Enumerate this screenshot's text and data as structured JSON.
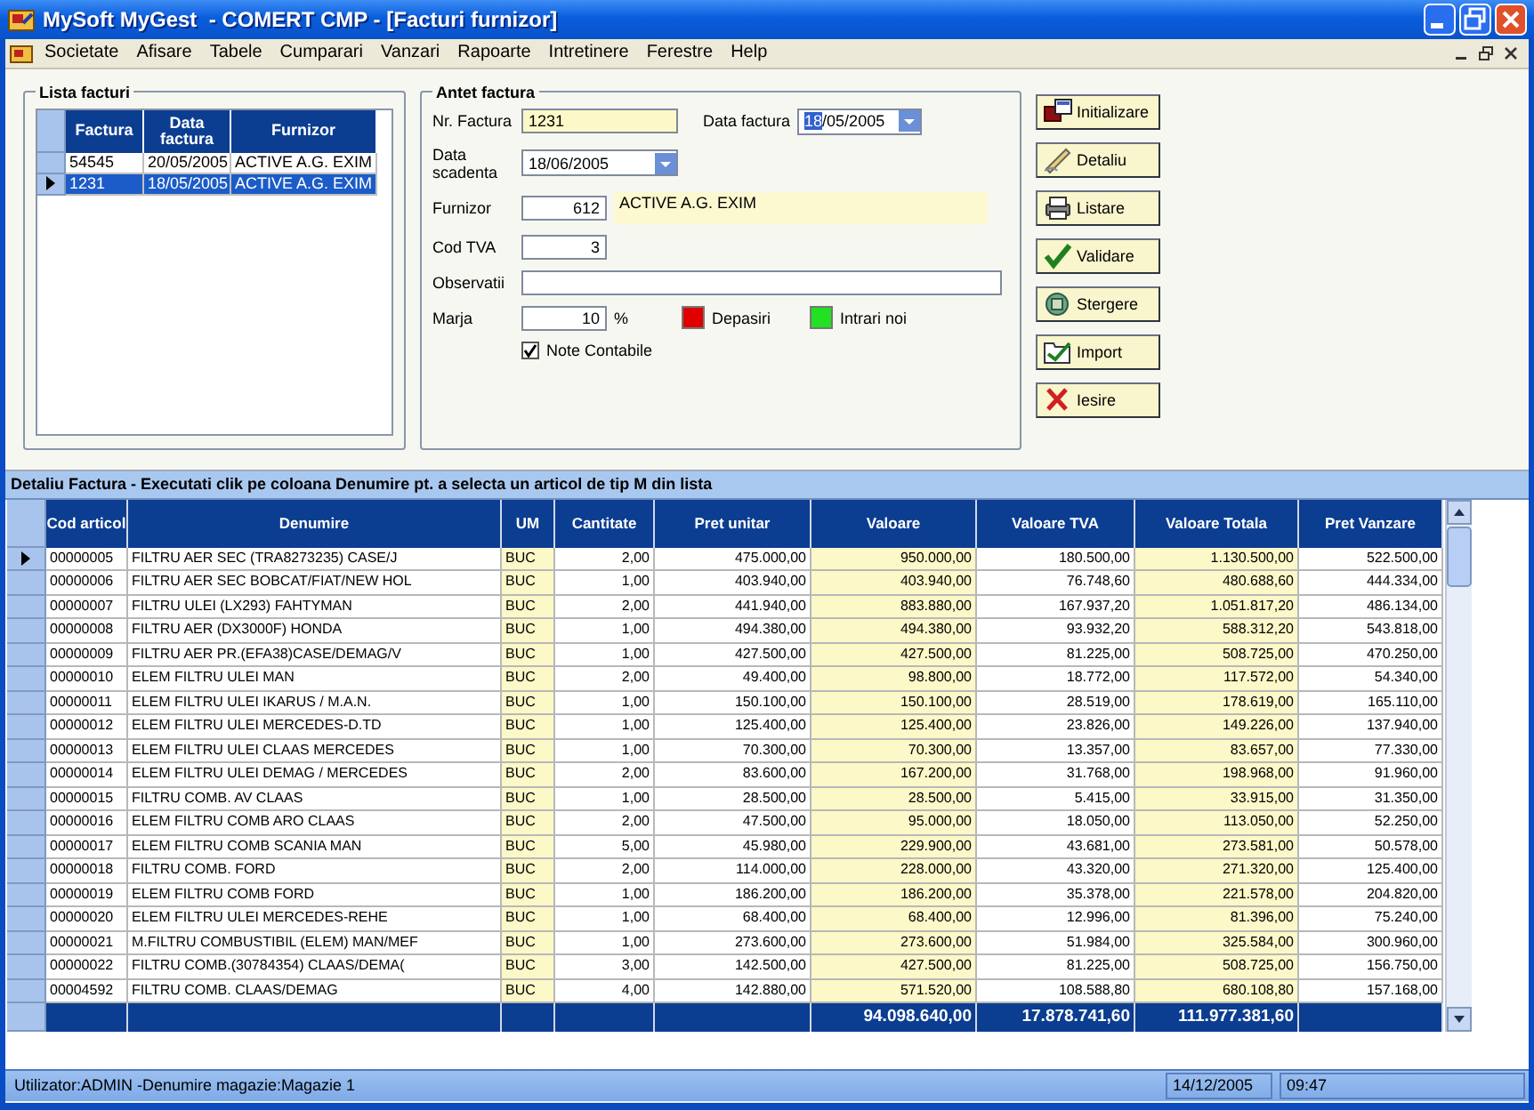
{
  "window": {
    "title": "MySoft MyGest  - COMERT CMP - [Facturi furnizor]"
  },
  "menu": [
    "Societate",
    "Afisare",
    "Tabele",
    "Cumparari",
    "Vanzari",
    "Rapoarte",
    "Intretinere",
    "Ferestre",
    "Help"
  ],
  "invoice_list": {
    "title": "Lista facturi",
    "columns": [
      "Factura",
      "Data factura",
      "Furnizor"
    ],
    "rows": [
      {
        "selected": false,
        "cells": [
          "54545",
          "20/05/2005",
          "ACTIVE A.G. EXIM"
        ]
      },
      {
        "selected": true,
        "cells": [
          "1231",
          "18/05/2005",
          "ACTIVE A.G. EXIM"
        ]
      }
    ]
  },
  "invoice_header": {
    "title": "Antet factura",
    "nr_factura": {
      "label": "Nr. Factura",
      "value": "1231"
    },
    "data_factura": {
      "label": "Data factura",
      "day": "18",
      "rest": "/05/2005",
      "day_selected": true
    },
    "data_scadenta": {
      "label": "Data scadenta",
      "value": "18/06/2005"
    },
    "furnizor": {
      "label": "Furnizor",
      "code": "612",
      "name": "ACTIVE A.G. EXIM"
    },
    "cod_tva": {
      "label": "Cod TVA",
      "value": "3"
    },
    "observatii": {
      "label": "Observatii"
    },
    "marja": {
      "label": "Marja",
      "value": "10",
      "unit": "%"
    },
    "legend": [
      {
        "label": "Depasiri",
        "color": "#e00000"
      },
      {
        "label": "Intrari noi",
        "color": "#22e022"
      }
    ],
    "note_contabile": {
      "label": "Note Contabile",
      "checked": true
    }
  },
  "buttons": [
    {
      "label": "Initializare",
      "kind": "new"
    },
    {
      "label": "Detaliu",
      "kind": "edit"
    },
    {
      "label": "Listare",
      "kind": "print"
    },
    {
      "label": "Validare",
      "kind": "validate"
    },
    {
      "label": "Stergere",
      "kind": "delete"
    },
    {
      "label": "Import",
      "kind": "import"
    },
    {
      "label": "Iesire",
      "kind": "exit"
    }
  ],
  "detail": {
    "title": "Detaliu Factura - Executati clik pe coloana Denumire pt. a selecta un articol de tip M din lista",
    "columns": [
      "Cod articol",
      "Denumire",
      "UM",
      "Cantitate",
      "Pret unitar",
      "Valoare",
      "Valoare TVA",
      "Valoare Totala",
      "Pret Vanzare"
    ],
    "rows": [
      {
        "current": true,
        "cells": [
          "00000005",
          "FILTRU AER SEC (TRA8273235) CASE/J",
          "BUC",
          "2,00",
          "475.000,00",
          "950.000,00",
          "180.500,00",
          "1.130.500,00",
          "522.500,00"
        ]
      },
      {
        "current": false,
        "cells": [
          "00000006",
          "FILTRU AER SEC BOBCAT/FIAT/NEW HOL",
          "BUC",
          "1,00",
          "403.940,00",
          "403.940,00",
          "76.748,60",
          "480.688,60",
          "444.334,00"
        ]
      },
      {
        "current": false,
        "cells": [
          "00000007",
          "FILTRU ULEI (LX293) FAHTYMAN",
          "BUC",
          "2,00",
          "441.940,00",
          "883.880,00",
          "167.937,20",
          "1.051.817,20",
          "486.134,00"
        ]
      },
      {
        "current": false,
        "cells": [
          "00000008",
          "FILTRU AER (DX3000F) HONDA",
          "BUC",
          "1,00",
          "494.380,00",
          "494.380,00",
          "93.932,20",
          "588.312,20",
          "543.818,00"
        ]
      },
      {
        "current": false,
        "cells": [
          "00000009",
          "FILTRU AER PR.(EFA38)CASE/DEMAG/V",
          "BUC",
          "1,00",
          "427.500,00",
          "427.500,00",
          "81.225,00",
          "508.725,00",
          "470.250,00"
        ]
      },
      {
        "current": false,
        "cells": [
          "00000010",
          "ELEM FILTRU ULEI MAN",
          "BUC",
          "2,00",
          "49.400,00",
          "98.800,00",
          "18.772,00",
          "117.572,00",
          "54.340,00"
        ]
      },
      {
        "current": false,
        "cells": [
          "00000011",
          "ELEM FILTRU ULEI IKARUS / M.A.N.",
          "BUC",
          "1,00",
          "150.100,00",
          "150.100,00",
          "28.519,00",
          "178.619,00",
          "165.110,00"
        ]
      },
      {
        "current": false,
        "cells": [
          "00000012",
          "ELEM FILTRU ULEI MERCEDES-D.TD",
          "BUC",
          "1,00",
          "125.400,00",
          "125.400,00",
          "23.826,00",
          "149.226,00",
          "137.940,00"
        ]
      },
      {
        "current": false,
        "cells": [
          "00000013",
          "ELEM FILTRU ULEI CLAAS MERCEDES",
          "BUC",
          "1,00",
          "70.300,00",
          "70.300,00",
          "13.357,00",
          "83.657,00",
          "77.330,00"
        ]
      },
      {
        "current": false,
        "cells": [
          "00000014",
          "ELEM FILTRU ULEI DEMAG / MERCEDES",
          "BUC",
          "2,00",
          "83.600,00",
          "167.200,00",
          "31.768,00",
          "198.968,00",
          "91.960,00"
        ]
      },
      {
        "current": false,
        "cells": [
          "00000015",
          "FILTRU COMB. AV CLAAS",
          "BUC",
          "1,00",
          "28.500,00",
          "28.500,00",
          "5.415,00",
          "33.915,00",
          "31.350,00"
        ]
      },
      {
        "current": false,
        "cells": [
          "00000016",
          "ELEM FILTRU COMB ARO CLAAS",
          "BUC",
          "2,00",
          "47.500,00",
          "95.000,00",
          "18.050,00",
          "113.050,00",
          "52.250,00"
        ]
      },
      {
        "current": false,
        "cells": [
          "00000017",
          "ELEM FILTRU COMB SCANIA MAN",
          "BUC",
          "5,00",
          "45.980,00",
          "229.900,00",
          "43.681,00",
          "273.581,00",
          "50.578,00"
        ]
      },
      {
        "current": false,
        "cells": [
          "00000018",
          "FILTRU COMB. FORD",
          "BUC",
          "2,00",
          "114.000,00",
          "228.000,00",
          "43.320,00",
          "271.320,00",
          "125.400,00"
        ]
      },
      {
        "current": false,
        "cells": [
          "00000019",
          "ELEM FILTRU COMB FORD",
          "BUC",
          "1,00",
          "186.200,00",
          "186.200,00",
          "35.378,00",
          "221.578,00",
          "204.820,00"
        ]
      },
      {
        "current": false,
        "cells": [
          "00000020",
          "ELEM FILTRU ULEI MERCEDES-REHE",
          "BUC",
          "1,00",
          "68.400,00",
          "68.400,00",
          "12.996,00",
          "81.396,00",
          "75.240,00"
        ]
      },
      {
        "current": false,
        "cells": [
          "00000021",
          "M.FILTRU COMBUSTIBIL (ELEM) MAN/MEF",
          "BUC",
          "1,00",
          "273.600,00",
          "273.600,00",
          "51.984,00",
          "325.584,00",
          "300.960,00"
        ]
      },
      {
        "current": false,
        "cells": [
          "00000022",
          "FILTRU COMB.(30784354) CLAAS/DEMA(",
          "BUC",
          "3,00",
          "142.500,00",
          "427.500,00",
          "81.225,00",
          "508.725,00",
          "156.750,00"
        ]
      },
      {
        "current": false,
        "cells": [
          "00004592",
          "FILTRU COMB. CLAAS/DEMAG",
          "BUC",
          "4,00",
          "142.880,00",
          "571.520,00",
          "108.588,80",
          "680.108,80",
          "157.168,00"
        ]
      }
    ],
    "totals": {
      "valoare": "94.098.640,00",
      "valoare_tva": "17.878.741,60",
      "valoare_totala": "111.977.381,60"
    }
  },
  "status_bar": {
    "info": "Utilizator:ADMIN -Denumire magazie:Magazie 1",
    "date": "14/12/2005",
    "time": "09:47"
  }
}
